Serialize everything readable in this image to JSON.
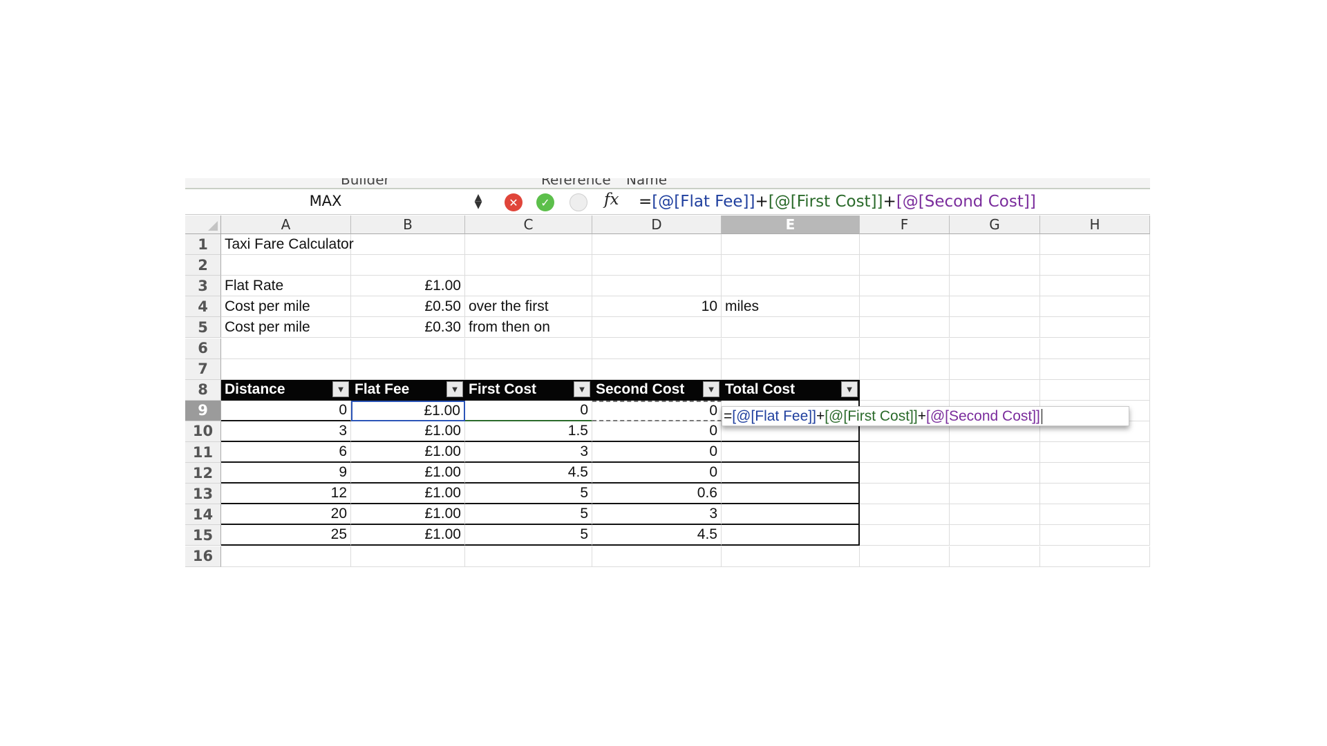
{
  "ribbon": {
    "labels": [
      "Builder",
      "Reference",
      "Name"
    ]
  },
  "formula_bar": {
    "name_box": "MAX",
    "spinner": "▲▼",
    "cancel_icon": "✕",
    "enter_icon": "✓",
    "fx_label": "fx",
    "formula": {
      "eq": "=",
      "ref1": "[@[Flat Fee]]",
      "plus1": "+",
      "ref2": "[@[First Cost]]",
      "plus2": "+",
      "ref3": "[@[Second Cost]]"
    }
  },
  "columns": [
    "A",
    "B",
    "C",
    "D",
    "E",
    "F",
    "G",
    "H"
  ],
  "selected_column": "E",
  "rows": [
    "1",
    "2",
    "3",
    "4",
    "5",
    "6",
    "7",
    "8",
    "9",
    "10",
    "11",
    "12",
    "13",
    "14",
    "15",
    "16"
  ],
  "selected_row": "9",
  "cells": {
    "A1": "Taxi Fare Calculator",
    "A3": "Flat Rate",
    "B3": "£1.00",
    "A4": "Cost per mile",
    "B4": "£0.50",
    "C4": "over the first",
    "D4": "10",
    "E4": "miles",
    "A5": "Cost per mile",
    "B5": "£0.30",
    "C5": "from then on"
  },
  "table": {
    "headers": [
      "Distance",
      "Flat Fee",
      "First Cost",
      "Second Cost",
      "Total Cost"
    ],
    "dropdown_icon": "▼",
    "rows": [
      [
        "0",
        "£1.00",
        "0",
        "0",
        ""
      ],
      [
        "3",
        "£1.00",
        "1.5",
        "0",
        ""
      ],
      [
        "6",
        "£1.00",
        "3",
        "0",
        ""
      ],
      [
        "9",
        "£1.00",
        "4.5",
        "0",
        ""
      ],
      [
        "12",
        "£1.00",
        "5",
        "0.6",
        ""
      ],
      [
        "20",
        "£1.00",
        "5",
        "3",
        ""
      ],
      [
        "25",
        "£1.00",
        "5",
        "4.5",
        ""
      ]
    ]
  },
  "colors": {
    "ref1": "#1f3f9e",
    "ref2": "#2a6a2a",
    "ref3": "#7a2c9c",
    "header_bg": "#050505"
  }
}
